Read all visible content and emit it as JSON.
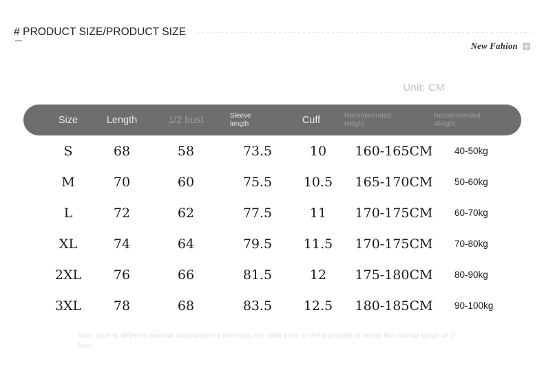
{
  "header": {
    "title": "# PRODUCT SIZE/PRODUCT SIZE",
    "brand_label": "New Fahion",
    "brand_icon": "plus-icon"
  },
  "unit_label": "Unit: CM",
  "table": {
    "columns": [
      {
        "key": "size",
        "label": "Size"
      },
      {
        "key": "length",
        "label": "Length"
      },
      {
        "key": "bust",
        "label": "1/2 bust"
      },
      {
        "key": "sleeve",
        "label_line1": "Sleeve",
        "label_line2": "length"
      },
      {
        "key": "cuff",
        "label": "Cuff"
      },
      {
        "key": "height",
        "label_line1": "Recommended",
        "label_line2": "Height"
      },
      {
        "key": "weight",
        "label_line1": "Recommended",
        "label_line2": "Weight"
      }
    ],
    "rows": [
      {
        "size": "S",
        "length": "68",
        "bust": "58",
        "sleeve": "73.5",
        "cuff": "10",
        "height": "160-165CM",
        "weight": "40-50kg"
      },
      {
        "size": "M",
        "length": "70",
        "bust": "60",
        "sleeve": "75.5",
        "cuff": "10.5",
        "height": "165-170CM",
        "weight": "50-60kg"
      },
      {
        "size": "L",
        "length": "72",
        "bust": "62",
        "sleeve": "77.5",
        "cuff": "11",
        "height": "170-175CM",
        "weight": "60-70kg"
      },
      {
        "size": "XL",
        "length": "74",
        "bust": "64",
        "sleeve": "79.5",
        "cuff": "11.5",
        "height": "170-175CM",
        "weight": "70-80kg"
      },
      {
        "size": "2XL",
        "length": "76",
        "bust": "66",
        "sleeve": "81.5",
        "cuff": "12",
        "height": "175-180CM",
        "weight": "80-90kg"
      },
      {
        "size": "3XL",
        "length": "78",
        "bust": "68",
        "sleeve": "83.5",
        "cuff": "12.5",
        "height": "180-185CM",
        "weight": "90-100kg"
      }
    ],
    "note": "Note: Due to different manual measurement methods, the data error of the size table is within the normal range of 1-3cm."
  },
  "colors": {
    "header_bar": "#6e6e6e",
    "header_text": "#e9e9e9",
    "header_text_dim": "#9d9d9d",
    "body_text": "#1a1a1a",
    "note_text": "#e0e0e2",
    "unit_text": "#c2c2c4"
  }
}
